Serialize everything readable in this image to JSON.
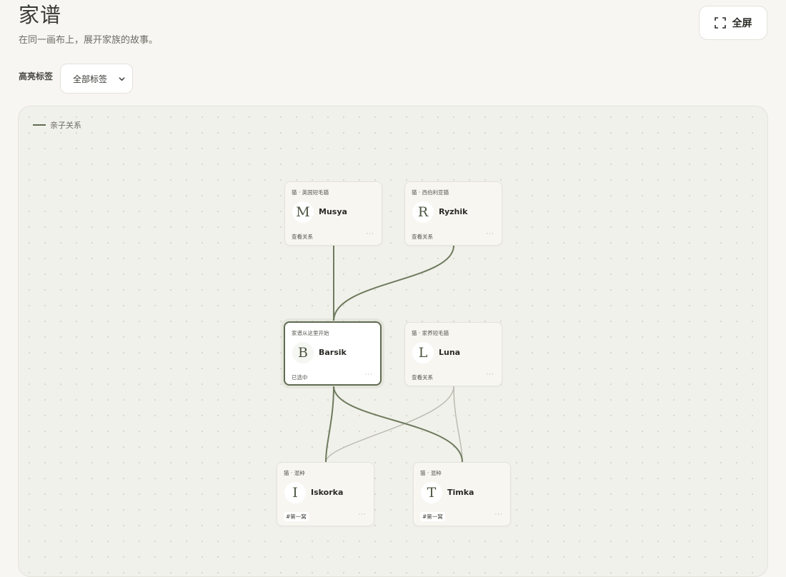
{
  "header": {
    "title": "家谱",
    "subtitle": "在同一画布上，展开家族的故事。",
    "fullscreen_label": "全屏"
  },
  "filter": {
    "label": "高亮标签",
    "selected": "全部标签"
  },
  "canvas": {
    "legend_label": "亲子关系",
    "nodes": [
      {
        "id": "musya",
        "tag": "猫 · 英国短毛猫",
        "initial": "M",
        "name": "Musya",
        "footer": "查看关系",
        "more": "···"
      },
      {
        "id": "ryzhik",
        "tag": "猫 · 西伯利亚猫",
        "initial": "R",
        "name": "Ryzhik",
        "footer": "查看关系",
        "more": "···"
      },
      {
        "id": "barsik",
        "tag": "家谱从这里开始",
        "initial": "B",
        "name": "Barsik",
        "footer": "已选中",
        "more": "···"
      },
      {
        "id": "luna",
        "tag": "猫 · 家养短毛猫",
        "initial": "L",
        "name": "Luna",
        "footer": "查看关系",
        "more": "···"
      },
      {
        "id": "iskorka",
        "tag": "猫 · 混种",
        "initial": "I",
        "name": "Iskorka",
        "badge": "#第一窝",
        "more": "···"
      },
      {
        "id": "timka",
        "tag": "猫 · 混种",
        "initial": "T",
        "name": "Timka",
        "badge": "#第一窝",
        "more": "···"
      }
    ]
  },
  "colors": {
    "edge_strong": "#6e7b5e",
    "edge_light": "#bcbcb2",
    "selected_border": "#5e6b50"
  }
}
